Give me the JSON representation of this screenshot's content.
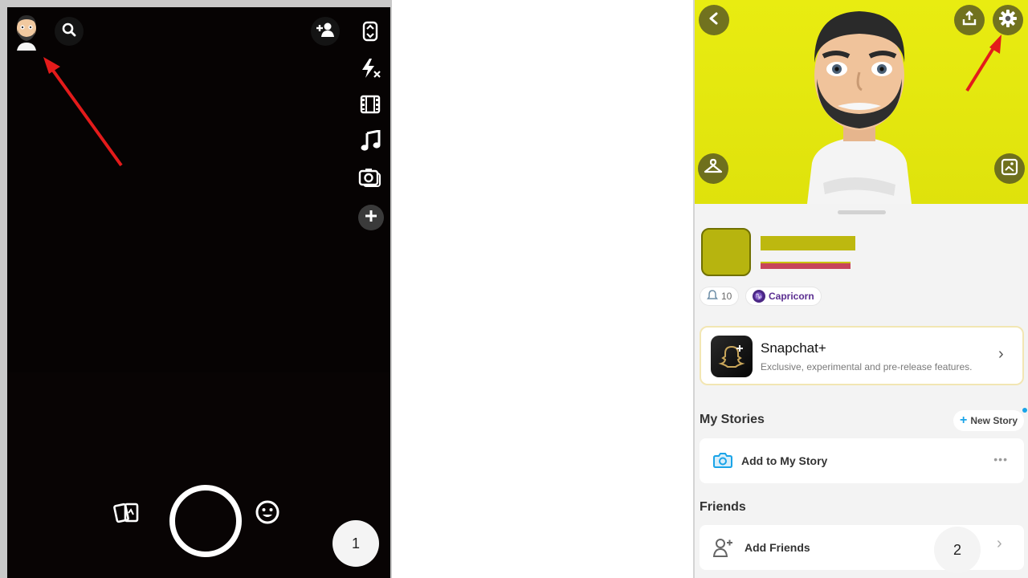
{
  "left_panel": {
    "step_number": "1",
    "icons": {
      "avatar": "bitmoji-avatar",
      "search": "search-icon",
      "add_friend": "add-friend-icon",
      "flip": "flip-camera-icon",
      "flash": "flash-off-icon",
      "video": "film-icon",
      "music": "music-note-icon",
      "multi_snap": "multi-snap-camera-icon",
      "more": "plus-icon",
      "memories": "memories-cards-icon",
      "lenses": "smiley-lens-icon"
    }
  },
  "right_panel": {
    "step_number": "2",
    "icons": {
      "back": "chevron-left-icon",
      "share": "share-upload-icon",
      "settings": "gear-icon",
      "wardrobe": "hanger-icon",
      "selfie": "selfie-image-icon"
    },
    "snapscore_chip": "10",
    "zodiac_chip": "Capricorn",
    "snapchat_plus": {
      "title": "Snapchat+",
      "subtitle": "Exclusive, experimental and pre-release features."
    },
    "my_stories": {
      "title": "My Stories",
      "new_story": "New Story",
      "add_to_story": "Add to My Story",
      "more": "•••"
    },
    "friends": {
      "title": "Friends",
      "add_friends": "Add Friends"
    }
  },
  "colors": {
    "header_yellow": "#e9ec11",
    "arrow_red": "#e31b1b",
    "accent_blue": "#1aa4e8"
  }
}
